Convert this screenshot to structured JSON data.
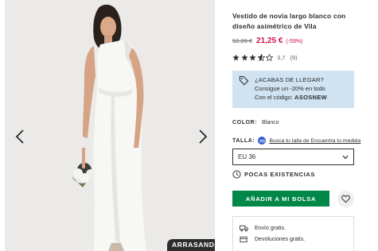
{
  "product": {
    "title": "Vestido de novia largo blanco con diseño asimétrico de Vila",
    "old_price": "52,99 €",
    "new_price": "21,25 €",
    "discount": "(-59%)",
    "rating_value": "3,7",
    "rating_count": "(9)",
    "stars": 3.7,
    "badge": "ARRASANDO"
  },
  "promo": {
    "headline": "¿ACABAS DE LLEGAR?",
    "line1": "Consigue un -20% en todo",
    "line2_prefix": "Con el código:",
    "code": "ASOSNEW"
  },
  "color": {
    "label": "COLOR:",
    "value": "Blanco"
  },
  "size": {
    "label": "TALLA:",
    "guide_link": "Busca tu talla de Encuentra tu medida",
    "selected": "EU 36"
  },
  "stock": {
    "label": "POCAS EXISTENCIAS"
  },
  "actions": {
    "add_to_bag": "AÑADIR A MI BOLSA"
  },
  "delivery": {
    "items": [
      {
        "icon": "truck-icon",
        "text": "Envío gratis."
      },
      {
        "icon": "return-icon",
        "text": "Devoluciones gratis."
      }
    ]
  },
  "colors": {
    "accent_green": "#018849",
    "price_red": "#d01345",
    "promo_blue": "#cfe3f3"
  },
  "icons": [
    "chevron-left-icon",
    "chevron-right-icon",
    "tag-icon",
    "ruler-icon",
    "chevron-down-icon",
    "clock-icon",
    "heart-icon",
    "truck-icon",
    "return-icon",
    "star-icon"
  ]
}
